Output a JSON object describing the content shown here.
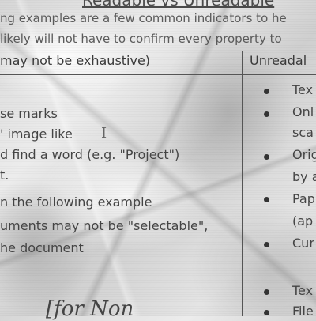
{
  "heading": "Readable vs Unreadable",
  "intro": [
    "ng examples are a few common indicators to he",
    "likely will not have to confirm every property to"
  ],
  "table": {
    "left_header": "may not be exhaustive)",
    "right_header": "Unreadal",
    "left_lines": [
      "se marks",
      "' image like",
      "d find a word (e.g. \"Project\")",
      "t.",
      "n the following example",
      "uments may not be \"selectable\",",
      "he document"
    ],
    "right_lines": [
      "Tex",
      "Onl",
      "sca",
      "Orig",
      "by a",
      "Pap",
      "(ap",
      "Cur",
      "Tex",
      "File"
    ]
  },
  "footer_note": "[for Non"
}
